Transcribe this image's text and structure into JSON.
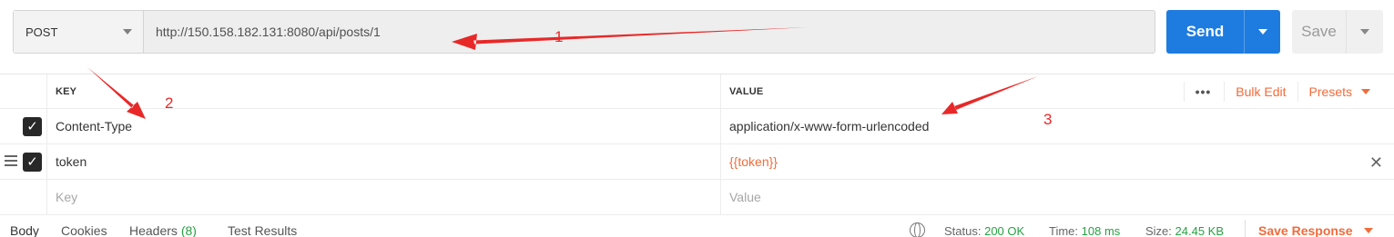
{
  "request": {
    "method": "POST",
    "url": "http://150.158.182.131:8080/api/posts/1"
  },
  "actions": {
    "send_label": "Send",
    "save_label": "Save"
  },
  "headers_table": {
    "columns": {
      "key": "KEY",
      "value": "VALUE"
    },
    "tools": {
      "more": "•••",
      "bulk_edit": "Bulk Edit",
      "presets": "Presets"
    },
    "rows": [
      {
        "checked": true,
        "key": "Content-Type",
        "value": "application/x-www-form-urlencoded"
      },
      {
        "checked": true,
        "key": "token",
        "value": "{{token}}"
      }
    ],
    "placeholders": {
      "key": "Key",
      "value": "Value"
    }
  },
  "response": {
    "tabs": [
      {
        "label": "Body"
      },
      {
        "label": "Cookies"
      },
      {
        "label": "Headers",
        "count": "(8)"
      },
      {
        "label": "Test Results"
      }
    ],
    "status_label": "Status:",
    "status_value": "200 OK",
    "time_label": "Time:",
    "time_value": "108 ms",
    "size_label": "Size:",
    "size_value": "24.45 KB",
    "save_response": "Save Response"
  },
  "annotations": [
    "1",
    "2",
    "3"
  ],
  "colors": {
    "accent": "#f26b3a",
    "send": "#1e7ce0",
    "success": "#27a243",
    "annotation": "#e82828"
  }
}
